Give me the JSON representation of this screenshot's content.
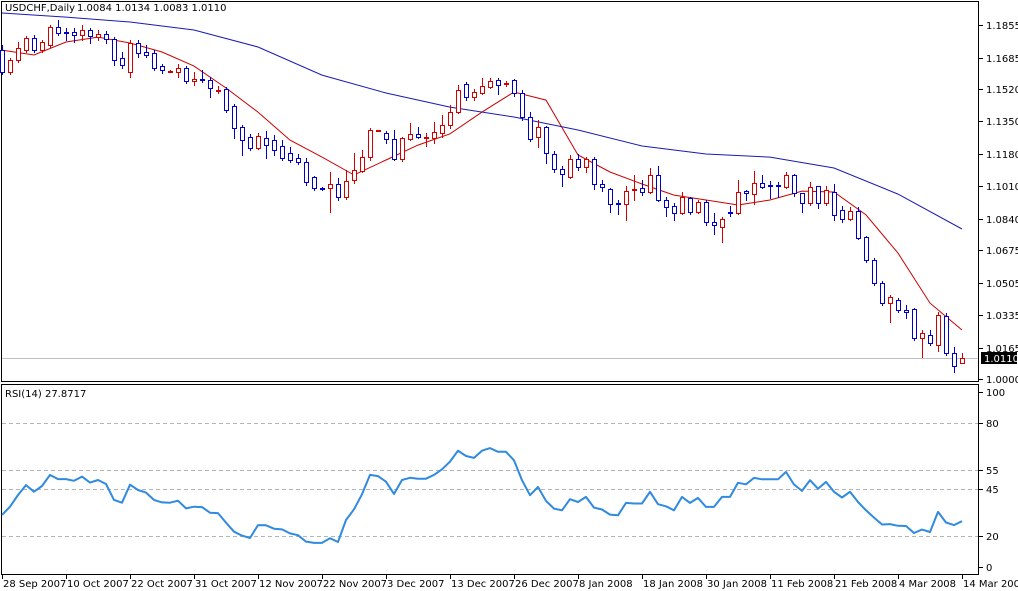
{
  "chart_data": {
    "type": "candlestick",
    "title": "USDCHF,Daily",
    "ohlc_header": "1.0084 1.0134 1.0083 1.0110",
    "current_price": "1.0110",
    "bullish_color": "#d40000",
    "bearish_color": "#0000c8",
    "grid": false,
    "price_axis": {
      "range": [
        1.0,
        1.1985
      ],
      "ticks": [
        "1.1855",
        "1.1685",
        "1.1520",
        "1.1350",
        "1.1180",
        "1.1010",
        "1.0840",
        "1.0675",
        "1.0505",
        "1.0335",
        "1.0165",
        "1.0000"
      ]
    },
    "x_labels": [
      "28 Sep 2007",
      "10 Oct 2007",
      "22 Oct 2007",
      "31 Oct 2007",
      "12 Nov 2007",
      "22 Nov 2007",
      "3 Dec 2007",
      "13 Dec 2007",
      "26 Dec 2007",
      "8 Jan 2008",
      "18 Jan 2008",
      "30 Jan 2008",
      "11 Feb 2008",
      "21 Feb 2008",
      "4 Mar 2008",
      "14 Mar 2008"
    ],
    "x_label_every_bars": 8,
    "candles_ohlc": [
      [
        1.1724,
        1.175,
        1.1598,
        1.1609
      ],
      [
        1.1609,
        1.1682,
        1.1598,
        1.1672
      ],
      [
        1.1672,
        1.1766,
        1.1661,
        1.1735
      ],
      [
        1.1724,
        1.1797,
        1.1714,
        1.1787
      ],
      [
        1.1787,
        1.1803,
        1.1714,
        1.1724
      ],
      [
        1.1724,
        1.1776,
        1.1714,
        1.1766
      ],
      [
        1.175,
        1.1855,
        1.174,
        1.1845
      ],
      [
        1.1845,
        1.1881,
        1.1803,
        1.1813
      ],
      [
        1.1818,
        1.1839,
        1.1776,
        1.1813
      ],
      [
        1.1818,
        1.1839,
        1.1766,
        1.1803
      ],
      [
        1.1803,
        1.1855,
        1.1776,
        1.1829
      ],
      [
        1.1829,
        1.1839,
        1.1761,
        1.1797
      ],
      [
        1.1792,
        1.1829,
        1.1776,
        1.1808
      ],
      [
        1.1808,
        1.1824,
        1.1761,
        1.1782
      ],
      [
        1.1782,
        1.1792,
        1.1645,
        1.1672
      ],
      [
        1.1682,
        1.1714,
        1.163,
        1.1645
      ],
      [
        1.1609,
        1.1776,
        1.1583,
        1.1761
      ],
      [
        1.1761,
        1.1776,
        1.1687,
        1.1708
      ],
      [
        1.1714,
        1.175,
        1.1687,
        1.1698
      ],
      [
        1.1708,
        1.1724,
        1.1619,
        1.163
      ],
      [
        1.164,
        1.1651,
        1.1603,
        1.1619
      ],
      [
        1.1609,
        1.1619,
        1.1609,
        1.1614
      ],
      [
        1.1609,
        1.1651,
        1.1583,
        1.163
      ],
      [
        1.163,
        1.164,
        1.1551,
        1.1562
      ],
      [
        1.1562,
        1.1609,
        1.1541,
        1.1572
      ],
      [
        1.1572,
        1.1619,
        1.1556,
        1.1567
      ],
      [
        1.1567,
        1.1583,
        1.1478,
        1.1525
      ],
      [
        1.1509,
        1.1535,
        1.1499,
        1.1514
      ],
      [
        1.152,
        1.153,
        1.1399,
        1.141
      ],
      [
        1.1431,
        1.1441,
        1.1263,
        1.1315
      ],
      [
        1.1321,
        1.1331,
        1.1174,
        1.1252
      ],
      [
        1.1268,
        1.1284,
        1.12,
        1.1211
      ],
      [
        1.1211,
        1.1289,
        1.1205,
        1.1273
      ],
      [
        1.1263,
        1.13,
        1.1158,
        1.1226
      ],
      [
        1.1252,
        1.1279,
        1.1174,
        1.12
      ],
      [
        1.1221,
        1.1252,
        1.1148,
        1.1158
      ],
      [
        1.1184,
        1.1216,
        1.1137,
        1.1148
      ],
      [
        1.1158,
        1.1179,
        1.1127,
        1.1137
      ],
      [
        1.1137,
        1.1158,
        1.1017,
        1.1032
      ],
      [
        1.1059,
        1.1064,
        1.099,
        1.1001
      ],
      [
        1.1001,
        1.1006,
        1.099,
        1.0996
      ],
      [
        1.1001,
        1.1085,
        1.0875,
        1.1022
      ],
      [
        1.1022,
        1.1053,
        1.0938,
        1.0954
      ],
      [
        1.0954,
        1.1095,
        1.0943,
        1.1038
      ],
      [
        1.1043,
        1.1184,
        1.1027,
        1.1095
      ],
      [
        1.109,
        1.12,
        1.1085,
        1.1163
      ],
      [
        1.1163,
        1.1315,
        1.1148,
        1.1305
      ],
      [
        1.13,
        1.1305,
        1.13,
        1.1305
      ],
      [
        1.1289,
        1.13,
        1.1237,
        1.1258
      ],
      [
        1.1258,
        1.1305,
        1.1148,
        1.1153
      ],
      [
        1.1153,
        1.1268,
        1.1142,
        1.1263
      ],
      [
        1.1258,
        1.1341,
        1.1252,
        1.1284
      ],
      [
        1.1284,
        1.1321,
        1.1263,
        1.1268
      ],
      [
        1.1263,
        1.1289,
        1.1221,
        1.1268
      ],
      [
        1.1263,
        1.1347,
        1.1237,
        1.1294
      ],
      [
        1.1289,
        1.1383,
        1.1268,
        1.1331
      ],
      [
        1.1331,
        1.1436,
        1.1315,
        1.1399
      ],
      [
        1.1399,
        1.1541,
        1.1394,
        1.1514
      ],
      [
        1.1546,
        1.1556,
        1.1462,
        1.1478
      ],
      [
        1.1478,
        1.152,
        1.1462,
        1.1504
      ],
      [
        1.1499,
        1.1577,
        1.1493,
        1.1535
      ],
      [
        1.153,
        1.1577,
        1.1525,
        1.1562
      ],
      [
        1.1567,
        1.1577,
        1.1493,
        1.1541
      ],
      [
        1.1546,
        1.1562,
        1.1535,
        1.1551
      ],
      [
        1.1567,
        1.1572,
        1.1483,
        1.1499
      ],
      [
        1.1499,
        1.1514,
        1.1357,
        1.1373
      ],
      [
        1.1373,
        1.1399,
        1.1247,
        1.1258
      ],
      [
        1.1268,
        1.1357,
        1.1216,
        1.1321
      ],
      [
        1.1321,
        1.1326,
        1.1132,
        1.1184
      ],
      [
        1.1179,
        1.1195,
        1.1085,
        1.11
      ],
      [
        1.11,
        1.1116,
        1.1011,
        1.1074
      ],
      [
        1.1059,
        1.1174,
        1.1053,
        1.1153
      ],
      [
        1.1153,
        1.1179,
        1.1095,
        1.1111
      ],
      [
        1.1111,
        1.1163,
        1.1085,
        1.1153
      ],
      [
        1.1153,
        1.1163,
        1.0996,
        1.1022
      ],
      [
        1.1022,
        1.1043,
        1.0985,
        1.1006
      ],
      [
        1.0996,
        1.1001,
        1.0875,
        1.0917
      ],
      [
        1.0922,
        1.0938,
        1.0865,
        1.0917
      ],
      [
        1.0917,
        1.1011,
        1.0833,
        1.0985
      ],
      [
        1.099,
        1.1069,
        1.0938,
        1.0996
      ],
      [
        1.1001,
        1.1043,
        1.0964,
        1.098
      ],
      [
        1.098,
        1.1106,
        1.0975,
        1.1069
      ],
      [
        1.1069,
        1.1116,
        1.0933,
        1.0938
      ],
      [
        1.0938,
        1.0954,
        1.0854,
        1.0901
      ],
      [
        1.0907,
        1.0922,
        1.0833,
        1.087
      ],
      [
        1.087,
        1.098,
        1.0865,
        1.0954
      ],
      [
        1.0948,
        1.0954,
        1.0865,
        1.0875
      ],
      [
        1.0875,
        1.0938,
        1.087,
        1.0928
      ],
      [
        1.0928,
        1.0938,
        1.0807,
        1.0823
      ],
      [
        1.0823,
        1.087,
        1.076,
        1.0807
      ],
      [
        1.0797,
        1.0849,
        1.0718,
        1.0838
      ],
      [
        1.0875,
        1.0907,
        1.0854,
        1.087
      ],
      [
        1.087,
        1.1043,
        1.0865,
        1.098
      ],
      [
        1.0985,
        1.099,
        1.0938,
        1.0975
      ],
      [
        1.0969,
        1.109,
        1.0917,
        1.1027
      ],
      [
        1.1027,
        1.1069,
        1.1001,
        1.1006
      ],
      [
        1.1017,
        1.1038,
        1.0948,
        1.1011
      ],
      [
        1.1017,
        1.1032,
        1.0954,
        1.1011
      ],
      [
        1.1006,
        1.1085,
        1.1001,
        1.1069
      ],
      [
        1.1069,
        1.1074,
        1.0959,
        1.0975
      ],
      [
        1.0975,
        1.0975,
        1.0875,
        1.0922
      ],
      [
        1.0922,
        1.1032,
        1.0912,
        1.1006
      ],
      [
        1.1011,
        1.1011,
        1.0896,
        1.0922
      ],
      [
        1.0922,
        1.1011,
        1.0912,
        1.099
      ],
      [
        1.098,
        1.1022,
        1.0833,
        1.086
      ],
      [
        1.0886,
        1.0907,
        1.0823,
        1.0838
      ],
      [
        1.0838,
        1.0901,
        1.0833,
        1.088
      ],
      [
        1.088,
        1.0901,
        1.0734,
        1.0739
      ],
      [
        1.0744,
        1.0749,
        1.0613,
        1.0624
      ],
      [
        1.0624,
        1.0634,
        1.0493,
        1.0503
      ],
      [
        1.0503,
        1.0514,
        1.0388,
        1.0398
      ],
      [
        1.0398,
        1.044,
        1.0299,
        1.043
      ],
      [
        1.0414,
        1.0425,
        1.0351,
        1.0362
      ],
      [
        1.0362,
        1.0388,
        1.032,
        1.0351
      ],
      [
        1.0367,
        1.0372,
        1.0204,
        1.0215
      ],
      [
        1.0215,
        1.0257,
        1.0115,
        1.0241
      ],
      [
        1.0231,
        1.0257,
        1.0178,
        1.0189
      ],
      [
        1.0178,
        1.0351,
        1.0147,
        1.0335
      ],
      [
        1.033,
        1.0346,
        1.0126,
        1.0136
      ],
      [
        1.0136,
        1.0168,
        1.0037,
        1.0068
      ],
      [
        1.0084,
        1.0134,
        1.0083,
        1.011
      ]
    ],
    "moving_averages": [
      {
        "color": "#cc0000",
        "points_bar_value": [
          [
            0,
            1.1724
          ],
          [
            4,
            1.1698
          ],
          [
            8,
            1.1766
          ],
          [
            12,
            1.1792
          ],
          [
            16,
            1.1761
          ],
          [
            20,
            1.1714
          ],
          [
            24,
            1.164
          ],
          [
            28,
            1.1525
          ],
          [
            32,
            1.1399
          ],
          [
            36,
            1.1252
          ],
          [
            40,
            1.1163
          ],
          [
            44,
            1.1069
          ],
          [
            48,
            1.1148
          ],
          [
            52,
            1.1226
          ],
          [
            56,
            1.1285
          ],
          [
            60,
            1.1399
          ],
          [
            64,
            1.1504
          ],
          [
            68,
            1.1462
          ],
          [
            72,
            1.1174
          ],
          [
            76,
            1.1085
          ],
          [
            80,
            1.1022
          ],
          [
            84,
            1.0964
          ],
          [
            88,
            1.0938
          ],
          [
            92,
            1.0912
          ],
          [
            96,
            1.0938
          ],
          [
            100,
            1.0985
          ],
          [
            104,
            1.098
          ],
          [
            108,
            1.086
          ],
          [
            112,
            1.066
          ],
          [
            116,
            1.0398
          ],
          [
            120,
            1.0257
          ]
        ]
      },
      {
        "color": "#1a1ab4",
        "points_bar_value": [
          [
            0,
            1.1918
          ],
          [
            8,
            1.1897
          ],
          [
            16,
            1.1871
          ],
          [
            24,
            1.1829
          ],
          [
            32,
            1.174
          ],
          [
            40,
            1.1593
          ],
          [
            48,
            1.1499
          ],
          [
            56,
            1.1425
          ],
          [
            64,
            1.1373
          ],
          [
            72,
            1.1305
          ],
          [
            80,
            1.1221
          ],
          [
            88,
            1.1179
          ],
          [
            96,
            1.1163
          ],
          [
            104,
            1.1106
          ],
          [
            112,
            1.0969
          ],
          [
            120,
            1.0786
          ]
        ]
      }
    ],
    "rsi": {
      "label": "RSI(14) 27.8717",
      "color": "#2f8ae0",
      "range": [
        0,
        100
      ],
      "ticks": [
        "100",
        "80",
        "55",
        "45",
        "20",
        "0"
      ],
      "levels": [
        80,
        55,
        45,
        20
      ],
      "values": [
        31.2,
        35.6,
        41.8,
        47.1,
        43.6,
        46.6,
        52.5,
        50.3,
        50.3,
        49.4,
        51.6,
        48.4,
        49.8,
        47.7,
        39.2,
        37.7,
        47.3,
        44.5,
        43.1,
        39.2,
        37.9,
        37.7,
        38.8,
        34.7,
        35.6,
        35.4,
        32.4,
        32.2,
        27.1,
        22.3,
        20.2,
        18.9,
        25.8,
        25.7,
        23.9,
        23.5,
        21.4,
        20.4,
        17.0,
        16.3,
        16.3,
        18.8,
        16.8,
        28.5,
        34.2,
        42.2,
        52.5,
        51.9,
        48.9,
        42.4,
        49.8,
        51.0,
        50.5,
        50.5,
        52.5,
        55.5,
        59.6,
        65.4,
        62.6,
        61.6,
        65.4,
        66.8,
        64.8,
        64.8,
        60.3,
        49.7,
        41.7,
        46.1,
        38.7,
        34.6,
        33.7,
        39.6,
        38.1,
        40.8,
        35.1,
        34.1,
        31.4,
        31.0,
        37.6,
        37.3,
        37.3,
        43.5,
        36.9,
        35.8,
        33.7,
        40.8,
        37.6,
        40.3,
        35.5,
        35.5,
        40.8,
        40.8,
        48.3,
        47.5,
        50.9,
        50.2,
        50.2,
        50.2,
        54.1,
        47.4,
        44.0,
        49.7,
        45.2,
        48.8,
        43.5,
        40.5,
        43.5,
        38.1,
        33.7,
        29.8,
        26.1,
        26.3,
        25.4,
        25.3,
        21.6,
        23.4,
        22.1,
        32.8,
        27.2,
        25.8,
        27.87
      ]
    }
  }
}
